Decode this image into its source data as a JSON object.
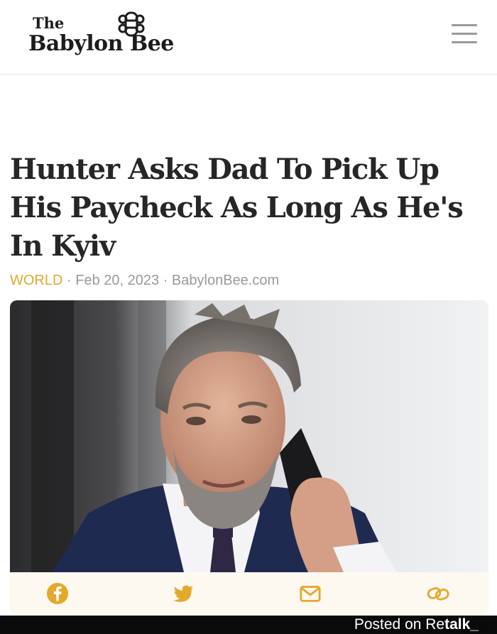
{
  "header": {
    "logo_top": "The",
    "logo_main": "Babylon Bee",
    "menu_icon": "hamburger-menu-icon",
    "logo_icon": "bee-icon"
  },
  "article": {
    "headline": "Hunter Asks Dad To Pick Up His Paycheck As Long As He's In Kyiv",
    "category": "WORLD",
    "separator": "·",
    "date": "Feb 20, 2023",
    "source": "BabylonBee.com",
    "photo": "man-on-phone-photo"
  },
  "share": {
    "icons": [
      "facebook-icon",
      "twitter-icon",
      "email-icon",
      "link-icon"
    ],
    "accent": "#e3a92b"
  },
  "watermark": {
    "prefix": "Posted on Re",
    "brand": "talk_"
  },
  "colors": {
    "accent": "#e3a92b",
    "headline": "#262626",
    "meta": "#9a9a9a"
  }
}
